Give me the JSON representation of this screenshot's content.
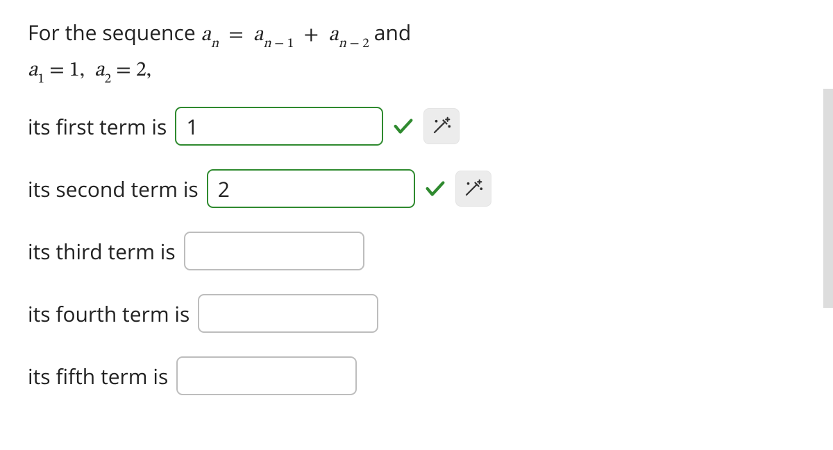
{
  "problem": {
    "sequence_symbol": "a",
    "index_symbol": "n",
    "text_for": "For the sequence",
    "text_and": "and",
    "initial_conditions_text": "a₁ = 1, a₂ = 2,"
  },
  "rows": [
    {
      "label": "its first term is",
      "value": "1",
      "correct": true,
      "show_magic": true
    },
    {
      "label": "its second term is",
      "value": "2",
      "correct": true,
      "show_magic": true
    },
    {
      "label": "its third term is",
      "value": "",
      "correct": false,
      "show_magic": false
    },
    {
      "label": "its fourth term is",
      "value": "",
      "correct": false,
      "show_magic": false
    },
    {
      "label": "its fifth term is",
      "value": "",
      "correct": false,
      "show_magic": false
    }
  ]
}
